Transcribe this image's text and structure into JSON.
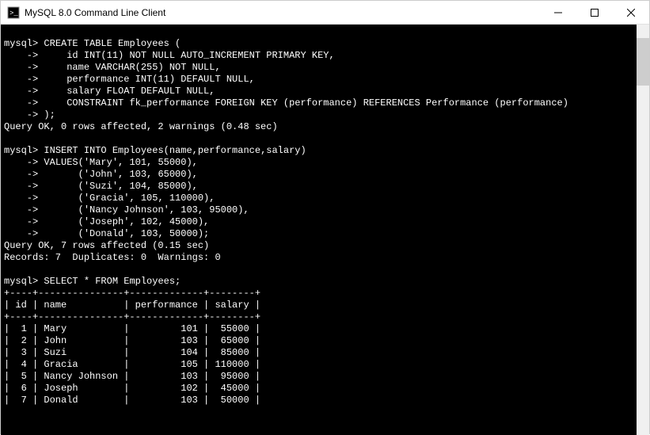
{
  "window": {
    "title": "MySQL 8.0 Command Line Client"
  },
  "terminal": {
    "prompt": "mysql>",
    "cont": "    ->",
    "create_stmt": {
      "line1": "CREATE TABLE Employees (",
      "line2": "    id INT(11) NOT NULL AUTO_INCREMENT PRIMARY KEY,",
      "line3": "    name VARCHAR(255) NOT NULL,",
      "line4": "    performance INT(11) DEFAULT NULL,",
      "line5": "    salary FLOAT DEFAULT NULL,",
      "line6": "    CONSTRAINT fk_performance FOREIGN KEY (performance) REFERENCES Performance (performance)",
      "line7": ");",
      "result": "Query OK, 0 rows affected, 2 warnings (0.48 sec)"
    },
    "insert_stmt": {
      "line1": "INSERT INTO Employees(name,performance,salary)",
      "line2": "VALUES('Mary', 101, 55000),",
      "line3": "      ('John', 103, 65000),",
      "line4": "      ('Suzi', 104, 85000),",
      "line5": "      ('Gracia', 105, 110000),",
      "line6": "      ('Nancy Johnson', 103, 95000),",
      "line7": "      ('Joseph', 102, 45000),",
      "line8": "      ('Donald', 103, 50000);",
      "result1": "Query OK, 7 rows affected (0.15 sec)",
      "result2": "Records: 7  Duplicates: 0  Warnings: 0"
    },
    "select_stmt": {
      "line1": "SELECT * FROM Employees;",
      "border": "+----+---------------+-------------+--------+",
      "header": "| id | name          | performance | salary |",
      "rows": [
        "|  1 | Mary          |         101 |  55000 |",
        "|  2 | John          |         103 |  65000 |",
        "|  3 | Suzi          |         104 |  85000 |",
        "|  4 | Gracia        |         105 | 110000 |",
        "|  5 | Nancy Johnson |         103 |  95000 |",
        "|  6 | Joseph        |         102 |  45000 |",
        "|  7 | Donald        |         103 |  50000 |"
      ]
    }
  },
  "chart_data": {
    "type": "table",
    "title": "Employees",
    "columns": [
      "id",
      "name",
      "performance",
      "salary"
    ],
    "rows": [
      {
        "id": 1,
        "name": "Mary",
        "performance": 101,
        "salary": 55000
      },
      {
        "id": 2,
        "name": "John",
        "performance": 103,
        "salary": 65000
      },
      {
        "id": 3,
        "name": "Suzi",
        "performance": 104,
        "salary": 85000
      },
      {
        "id": 4,
        "name": "Gracia",
        "performance": 105,
        "salary": 110000
      },
      {
        "id": 5,
        "name": "Nancy Johnson",
        "performance": 103,
        "salary": 95000
      },
      {
        "id": 6,
        "name": "Joseph",
        "performance": 102,
        "salary": 45000
      },
      {
        "id": 7,
        "name": "Donald",
        "performance": 103,
        "salary": 50000
      }
    ]
  }
}
